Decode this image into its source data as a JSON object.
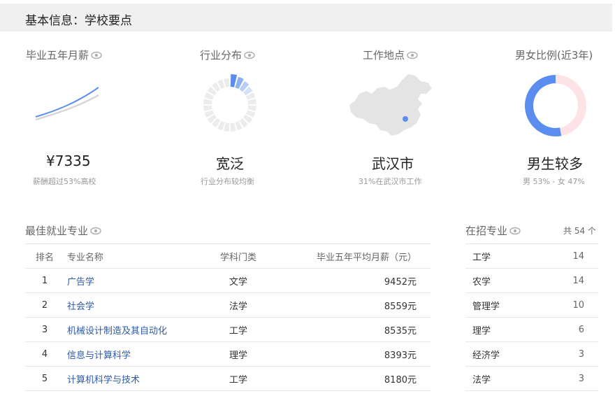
{
  "header": {
    "title": "基本信息：学校要点"
  },
  "stats": {
    "salary": {
      "title": "毕业五年月薪",
      "value": "¥7335",
      "sub": "薪酬超过53%高校"
    },
    "industry": {
      "title": "行业分布",
      "value": "宽泛",
      "sub": "行业分布较均衡"
    },
    "location": {
      "title": "工作地点",
      "value": "武汉市",
      "sub": "31%在武汉市工作"
    },
    "gender": {
      "title": "男女比例(近3年)",
      "value": "男生较多",
      "sub": "男 53% - 女 47%",
      "male_share": 53,
      "female_share": 47
    }
  },
  "colors": {
    "accent": "#5b8def",
    "female": "#fde3e6",
    "link": "#2e5aa8"
  },
  "best_majors": {
    "title": "最佳就业专业",
    "headers": {
      "rank": "排名",
      "name": "专业名称",
      "category": "学科门类",
      "salary": "毕业五年平均月薪（元）"
    },
    "rows": [
      {
        "rank": "1",
        "name": "广告学",
        "category": "文学",
        "salary": "9452元"
      },
      {
        "rank": "2",
        "name": "社会学",
        "category": "法学",
        "salary": "8559元"
      },
      {
        "rank": "3",
        "name": "机械设计制造及其自动化",
        "category": "工学",
        "salary": "8535元"
      },
      {
        "rank": "4",
        "name": "信息与计算科学",
        "category": "理学",
        "salary": "8393元"
      },
      {
        "rank": "5",
        "name": "计算机科学与技术",
        "category": "工学",
        "salary": "8180元"
      }
    ]
  },
  "enrolled": {
    "title": "在招专业",
    "total": "共 54 个",
    "rows": [
      {
        "name": "工学",
        "count": "14"
      },
      {
        "name": "农学",
        "count": "14"
      },
      {
        "name": "管理学",
        "count": "10"
      },
      {
        "name": "理学",
        "count": "6"
      },
      {
        "name": "经济学",
        "count": "3"
      },
      {
        "name": "法学",
        "count": "3"
      }
    ]
  },
  "icons": {
    "eye": "eye-icon",
    "map": "china-map-icon",
    "marker": "location-marker-icon"
  }
}
